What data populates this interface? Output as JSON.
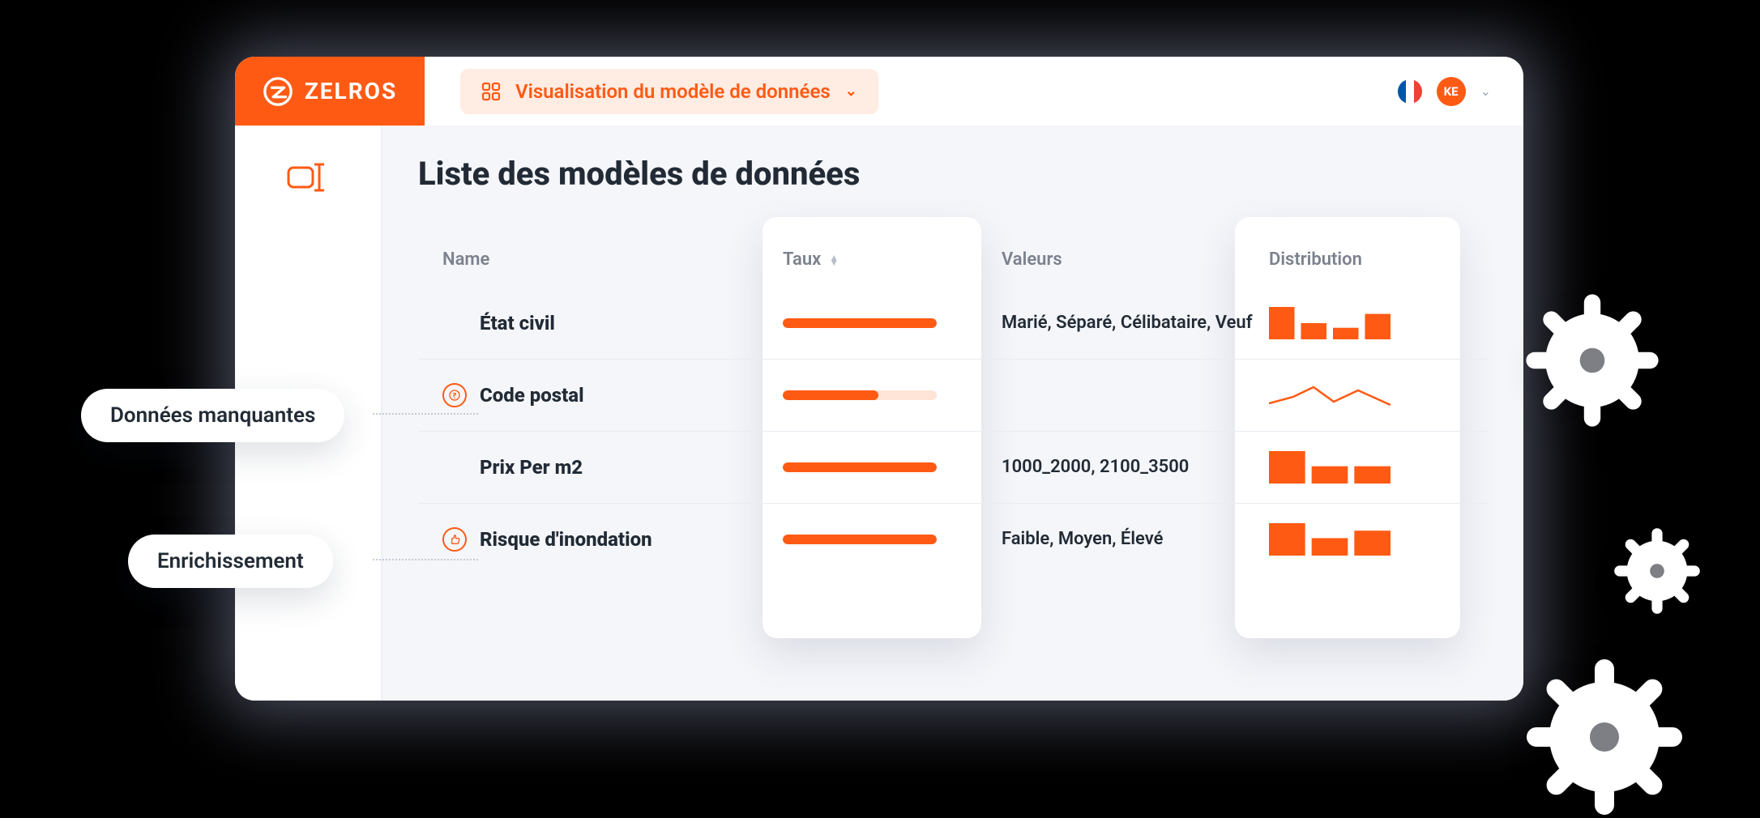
{
  "brand": {
    "name": "ZELROS"
  },
  "topbar": {
    "mode_label": "Visualisation du modèle de données",
    "avatar_initials": "KE"
  },
  "page": {
    "title": "Liste des modèles de données"
  },
  "table": {
    "headers": {
      "name": "Name",
      "rate": "Taux",
      "values": "Valeurs",
      "distribution": "Distribution"
    },
    "rows": [
      {
        "name": "État civil",
        "badge": null,
        "rate_pct": 100,
        "values": "Marié, Séparé, Célibataire, Veuf",
        "dist_type": "bars",
        "dist_bars": [
          28,
          14,
          10,
          22
        ]
      },
      {
        "name": "Code postal",
        "badge": "warning",
        "rate_pct": 62,
        "values": "",
        "dist_type": "sparkline"
      },
      {
        "name": "Prix Per m2",
        "badge": null,
        "rate_pct": 100,
        "values": "1000_2000, 2100_3500",
        "dist_type": "bars",
        "dist_bars": [
          30,
          16,
          16
        ]
      },
      {
        "name": "Risque d'inondation",
        "badge": "thumbs-up",
        "rate_pct": 100,
        "values": "Faible, Moyen, Élevé",
        "dist_type": "bars",
        "dist_bars": [
          26,
          14,
          20
        ]
      }
    ]
  },
  "callouts": {
    "missing": "Données manquantes",
    "enrichment": "Enrichissement"
  },
  "colors": {
    "accent": "#ff5a14"
  }
}
